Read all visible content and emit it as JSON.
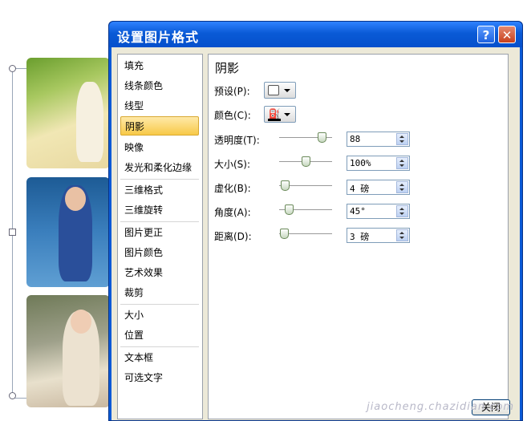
{
  "dialog": {
    "title": "设置图片格式",
    "help_glyph": "?",
    "close_glyph": "✕",
    "close_button": "关闭"
  },
  "categories": [
    {
      "label": "填充",
      "selected": false
    },
    {
      "label": "线条颜色",
      "selected": false
    },
    {
      "label": "线型",
      "selected": false
    },
    {
      "label": "阴影",
      "selected": true
    },
    {
      "label": "映像",
      "selected": false
    },
    {
      "label": "发光和柔化边缘",
      "selected": false
    },
    {
      "label": "三维格式",
      "selected": false
    },
    {
      "label": "三维旋转",
      "selected": false
    },
    {
      "label": "图片更正",
      "selected": false
    },
    {
      "label": "图片颜色",
      "selected": false
    },
    {
      "label": "艺术效果",
      "selected": false
    },
    {
      "label": "裁剪",
      "selected": false
    },
    {
      "label": "大小",
      "selected": false
    },
    {
      "label": "位置",
      "selected": false
    },
    {
      "label": "文本框",
      "selected": false
    },
    {
      "label": "可选文字",
      "selected": false
    }
  ],
  "panel": {
    "section_title": "阴影",
    "preset": {
      "label": "预设(P):"
    },
    "color": {
      "label": "颜色(C):",
      "bucket_icon": "⛽"
    },
    "rows": [
      {
        "label": "透明度(T):",
        "value": "88",
        "slider_fraction": 0.88
      },
      {
        "label": "大小(S):",
        "value": "100%",
        "slider_fraction": 0.5
      },
      {
        "label": "虚化(B):",
        "value": "4 磅",
        "slider_fraction": 0.04
      },
      {
        "label": "角度(A):",
        "value": "45°",
        "slider_fraction": 0.125
      },
      {
        "label": "距离(D):",
        "value": "3 磅",
        "slider_fraction": 0.02
      }
    ]
  },
  "watermark": "jiaocheng.chazidian.com"
}
